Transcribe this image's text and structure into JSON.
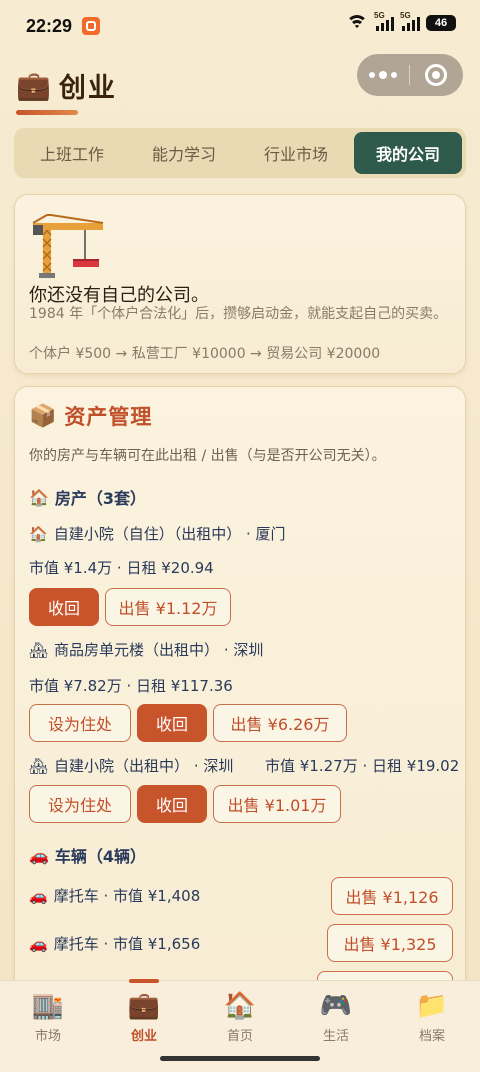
{
  "status": {
    "time": "22:29",
    "battery": "46",
    "net1": "5G",
    "net2": "5G"
  },
  "header": {
    "icon": "briefcase-icon",
    "title": "创业"
  },
  "tabs": [
    {
      "label": "上班工作",
      "active": false
    },
    {
      "label": "能力学习",
      "active": false
    },
    {
      "label": "行业市场",
      "active": false
    },
    {
      "label": "我的公司",
      "active": true
    }
  ],
  "company": {
    "icon": "crane-icon",
    "message": "你还没有自己的公司。",
    "description": "1984 年「个体户合法化」后，攒够启动金，就能支起自己的买卖。",
    "path": "个体户 ¥500 → 私营工厂 ¥10000 → 贸易公司 ¥20000"
  },
  "assets": {
    "icon": "package-icon",
    "title": "资产管理",
    "note": "你的房产与车辆可在此出租 / 出售（与是否开公司无关）。",
    "property_heading": "房产（3套）",
    "properties": [
      {
        "icon": "house-icon",
        "title": "自建小院（自住）（出租中） · 厦门",
        "meta": "市值 ¥1.4万 · 日租 ¥20.94",
        "reclaim": "收回",
        "sell": "出售 ¥1.12万"
      },
      {
        "icon": "houses-icon",
        "title": "商品房单元楼（出租中） · 深圳",
        "meta": "市值 ¥7.82万 · 日租 ¥117.36",
        "set_home": "设为住处",
        "reclaim": "收回",
        "sell": "出售 ¥6.26万"
      },
      {
        "icon": "houses-icon",
        "title": "自建小院（出租中） · 深圳",
        "meta": "市值 ¥1.27万 · 日租 ¥19.02",
        "set_home": "设为住处",
        "reclaim": "收回",
        "sell": "出售 ¥1.01万"
      }
    ],
    "vehicle_heading": "车辆（4辆）",
    "vehicles": [
      {
        "icon": "car-icon",
        "label": "摩托车 · 市值 ¥1,408",
        "sell": "出售 ¥1,126"
      },
      {
        "icon": "car-icon",
        "label": "摩托车 · 市值 ¥1,656",
        "sell": "出售 ¥1,325"
      }
    ]
  },
  "nav": [
    {
      "icon": "building-icon",
      "label": "市场",
      "active": false
    },
    {
      "icon": "briefcase-icon",
      "label": "创业",
      "active": true
    },
    {
      "icon": "home-icon",
      "label": "首页",
      "active": false
    },
    {
      "icon": "gamepad-icon",
      "label": "生活",
      "active": false
    },
    {
      "icon": "folder-icon",
      "label": "档案",
      "active": false
    }
  ]
}
